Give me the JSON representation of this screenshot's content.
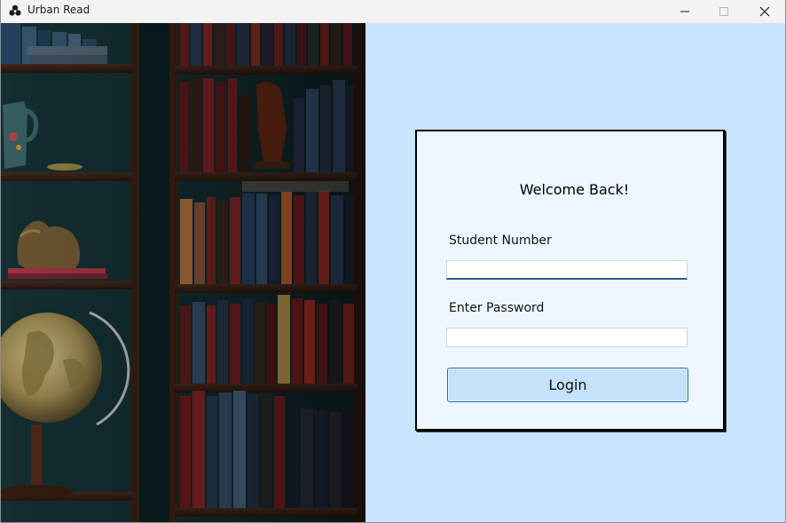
{
  "window": {
    "title": "Urban Read",
    "icon": "urban-read-app-icon",
    "controls": [
      "minimize-icon",
      "maximize-icon",
      "close-icon"
    ]
  },
  "photo": {
    "description_icon": "bookshelf-photo"
  },
  "login": {
    "heading": "Welcome Back!",
    "student_label": "Student Number",
    "student_value": "",
    "password_label": "Enter Password",
    "password_value": "",
    "button_label": "Login"
  },
  "colors": {
    "panel_background": "#c9e4ff",
    "card_background": "#eef6ff",
    "button_background": "#c6e2fa",
    "button_border": "#1c6ea8",
    "input_focus": "#1f5fa0"
  }
}
